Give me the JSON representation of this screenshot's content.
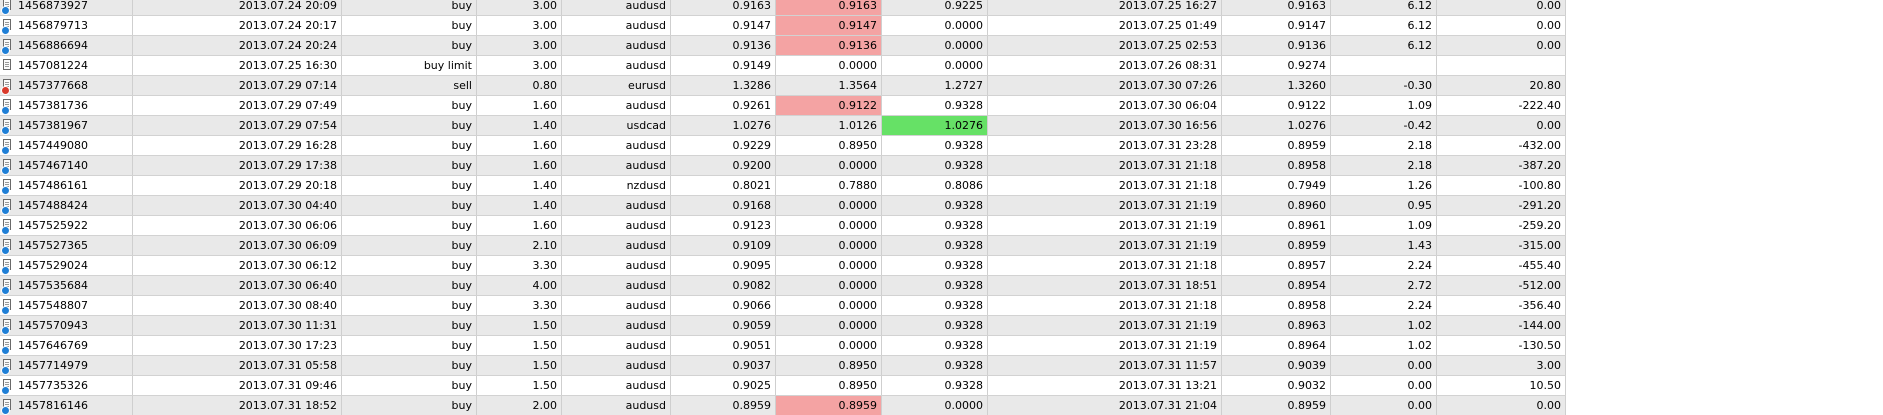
{
  "colors": {
    "row_alt": "#e9e9e9",
    "row": "#ffffff",
    "highlight_red": "#f4a3a3",
    "highlight_green": "#66e166",
    "buy_badge": "#1f7fd6",
    "sell_badge": "#d93a2b"
  },
  "icons": {
    "row_icon": "order-document-icon"
  },
  "rows": [
    {
      "ticket": "1456873927",
      "open_time": "2013.07.24 20:09",
      "type": "buy",
      "size": "3.00",
      "symbol": "audusd",
      "open_price": "0.9163",
      "sl": "0.9163",
      "tp": "0.9225",
      "close_time": "2013.07.25 16:27",
      "price": "0.9163",
      "swap": "6.12",
      "profit": "0.00",
      "hl_sl": "red",
      "hl_tp": ""
    },
    {
      "ticket": "1456879713",
      "open_time": "2013.07.24 20:17",
      "type": "buy",
      "size": "3.00",
      "symbol": "audusd",
      "open_price": "0.9147",
      "sl": "0.9147",
      "tp": "0.0000",
      "close_time": "2013.07.25 01:49",
      "price": "0.9147",
      "swap": "6.12",
      "profit": "0.00",
      "hl_sl": "red",
      "hl_tp": ""
    },
    {
      "ticket": "1456886694",
      "open_time": "2013.07.24 20:24",
      "type": "buy",
      "size": "3.00",
      "symbol": "audusd",
      "open_price": "0.9136",
      "sl": "0.9136",
      "tp": "0.0000",
      "close_time": "2013.07.25 02:53",
      "price": "0.9136",
      "swap": "6.12",
      "profit": "0.00",
      "hl_sl": "red",
      "hl_tp": ""
    },
    {
      "ticket": "1457081224",
      "open_time": "2013.07.25 16:30",
      "type": "buy limit",
      "size": "3.00",
      "symbol": "audusd",
      "open_price": "0.9149",
      "sl": "0.0000",
      "tp": "0.0000",
      "close_time": "2013.07.26 08:31",
      "price": "0.9274",
      "swap": "",
      "profit": "",
      "hl_sl": "",
      "hl_tp": ""
    },
    {
      "ticket": "1457377668",
      "open_time": "2013.07.29 07:14",
      "type": "sell",
      "size": "0.80",
      "symbol": "eurusd",
      "open_price": "1.3286",
      "sl": "1.3564",
      "tp": "1.2727",
      "close_time": "2013.07.30 07:26",
      "price": "1.3260",
      "swap": "-0.30",
      "profit": "20.80",
      "hl_sl": "",
      "hl_tp": ""
    },
    {
      "ticket": "1457381736",
      "open_time": "2013.07.29 07:49",
      "type": "buy",
      "size": "1.60",
      "symbol": "audusd",
      "open_price": "0.9261",
      "sl": "0.9122",
      "tp": "0.9328",
      "close_time": "2013.07.30 06:04",
      "price": "0.9122",
      "swap": "1.09",
      "profit": "-222.40",
      "hl_sl": "red",
      "hl_tp": ""
    },
    {
      "ticket": "1457381967",
      "open_time": "2013.07.29 07:54",
      "type": "buy",
      "size": "1.40",
      "symbol": "usdcad",
      "open_price": "1.0276",
      "sl": "1.0126",
      "tp": "1.0276",
      "close_time": "2013.07.30 16:56",
      "price": "1.0276",
      "swap": "-0.42",
      "profit": "0.00",
      "hl_sl": "",
      "hl_tp": "green"
    },
    {
      "ticket": "1457449080",
      "open_time": "2013.07.29 16:28",
      "type": "buy",
      "size": "1.60",
      "symbol": "audusd",
      "open_price": "0.9229",
      "sl": "0.8950",
      "tp": "0.9328",
      "close_time": "2013.07.31 23:28",
      "price": "0.8959",
      "swap": "2.18",
      "profit": "-432.00",
      "hl_sl": "",
      "hl_tp": ""
    },
    {
      "ticket": "1457467140",
      "open_time": "2013.07.29 17:38",
      "type": "buy",
      "size": "1.60",
      "symbol": "audusd",
      "open_price": "0.9200",
      "sl": "0.0000",
      "tp": "0.9328",
      "close_time": "2013.07.31 21:18",
      "price": "0.8958",
      "swap": "2.18",
      "profit": "-387.20",
      "hl_sl": "",
      "hl_tp": ""
    },
    {
      "ticket": "1457486161",
      "open_time": "2013.07.29 20:18",
      "type": "buy",
      "size": "1.40",
      "symbol": "nzdusd",
      "open_price": "0.8021",
      "sl": "0.7880",
      "tp": "0.8086",
      "close_time": "2013.07.31 21:18",
      "price": "0.7949",
      "swap": "1.26",
      "profit": "-100.80",
      "hl_sl": "",
      "hl_tp": ""
    },
    {
      "ticket": "1457488424",
      "open_time": "2013.07.30 04:40",
      "type": "buy",
      "size": "1.40",
      "symbol": "audusd",
      "open_price": "0.9168",
      "sl": "0.0000",
      "tp": "0.9328",
      "close_time": "2013.07.31 21:19",
      "price": "0.8960",
      "swap": "0.95",
      "profit": "-291.20",
      "hl_sl": "",
      "hl_tp": ""
    },
    {
      "ticket": "1457525922",
      "open_time": "2013.07.30 06:06",
      "type": "buy",
      "size": "1.60",
      "symbol": "audusd",
      "open_price": "0.9123",
      "sl": "0.0000",
      "tp": "0.9328",
      "close_time": "2013.07.31 21:19",
      "price": "0.8961",
      "swap": "1.09",
      "profit": "-259.20",
      "hl_sl": "",
      "hl_tp": ""
    },
    {
      "ticket": "1457527365",
      "open_time": "2013.07.30 06:09",
      "type": "buy",
      "size": "2.10",
      "symbol": "audusd",
      "open_price": "0.9109",
      "sl": "0.0000",
      "tp": "0.9328",
      "close_time": "2013.07.31 21:19",
      "price": "0.8959",
      "swap": "1.43",
      "profit": "-315.00",
      "hl_sl": "",
      "hl_tp": ""
    },
    {
      "ticket": "1457529024",
      "open_time": "2013.07.30 06:12",
      "type": "buy",
      "size": "3.30",
      "symbol": "audusd",
      "open_price": "0.9095",
      "sl": "0.0000",
      "tp": "0.9328",
      "close_time": "2013.07.31 21:18",
      "price": "0.8957",
      "swap": "2.24",
      "profit": "-455.40",
      "hl_sl": "",
      "hl_tp": ""
    },
    {
      "ticket": "1457535684",
      "open_time": "2013.07.30 06:40",
      "type": "buy",
      "size": "4.00",
      "symbol": "audusd",
      "open_price": "0.9082",
      "sl": "0.0000",
      "tp": "0.9328",
      "close_time": "2013.07.31 18:51",
      "price": "0.8954",
      "swap": "2.72",
      "profit": "-512.00",
      "hl_sl": "",
      "hl_tp": ""
    },
    {
      "ticket": "1457548807",
      "open_time": "2013.07.30 08:40",
      "type": "buy",
      "size": "3.30",
      "symbol": "audusd",
      "open_price": "0.9066",
      "sl": "0.0000",
      "tp": "0.9328",
      "close_time": "2013.07.31 21:18",
      "price": "0.8958",
      "swap": "2.24",
      "profit": "-356.40",
      "hl_sl": "",
      "hl_tp": ""
    },
    {
      "ticket": "1457570943",
      "open_time": "2013.07.30 11:31",
      "type": "buy",
      "size": "1.50",
      "symbol": "audusd",
      "open_price": "0.9059",
      "sl": "0.0000",
      "tp": "0.9328",
      "close_time": "2013.07.31 21:19",
      "price": "0.8963",
      "swap": "1.02",
      "profit": "-144.00",
      "hl_sl": "",
      "hl_tp": ""
    },
    {
      "ticket": "1457646769",
      "open_time": "2013.07.30 17:23",
      "type": "buy",
      "size": "1.50",
      "symbol": "audusd",
      "open_price": "0.9051",
      "sl": "0.0000",
      "tp": "0.9328",
      "close_time": "2013.07.31 21:19",
      "price": "0.8964",
      "swap": "1.02",
      "profit": "-130.50",
      "hl_sl": "",
      "hl_tp": ""
    },
    {
      "ticket": "1457714979",
      "open_time": "2013.07.31 05:58",
      "type": "buy",
      "size": "1.50",
      "symbol": "audusd",
      "open_price": "0.9037",
      "sl": "0.8950",
      "tp": "0.9328",
      "close_time": "2013.07.31 11:57",
      "price": "0.9039",
      "swap": "0.00",
      "profit": "3.00",
      "hl_sl": "",
      "hl_tp": ""
    },
    {
      "ticket": "1457735326",
      "open_time": "2013.07.31 09:46",
      "type": "buy",
      "size": "1.50",
      "symbol": "audusd",
      "open_price": "0.9025",
      "sl": "0.8950",
      "tp": "0.9328",
      "close_time": "2013.07.31 13:21",
      "price": "0.9032",
      "swap": "0.00",
      "profit": "10.50",
      "hl_sl": "",
      "hl_tp": ""
    },
    {
      "ticket": "1457816146",
      "open_time": "2013.07.31 18:52",
      "type": "buy",
      "size": "2.00",
      "symbol": "audusd",
      "open_price": "0.8959",
      "sl": "0.8959",
      "tp": "0.0000",
      "close_time": "2013.07.31 21:04",
      "price": "0.8959",
      "swap": "0.00",
      "profit": "0.00",
      "hl_sl": "red",
      "hl_tp": ""
    }
  ]
}
